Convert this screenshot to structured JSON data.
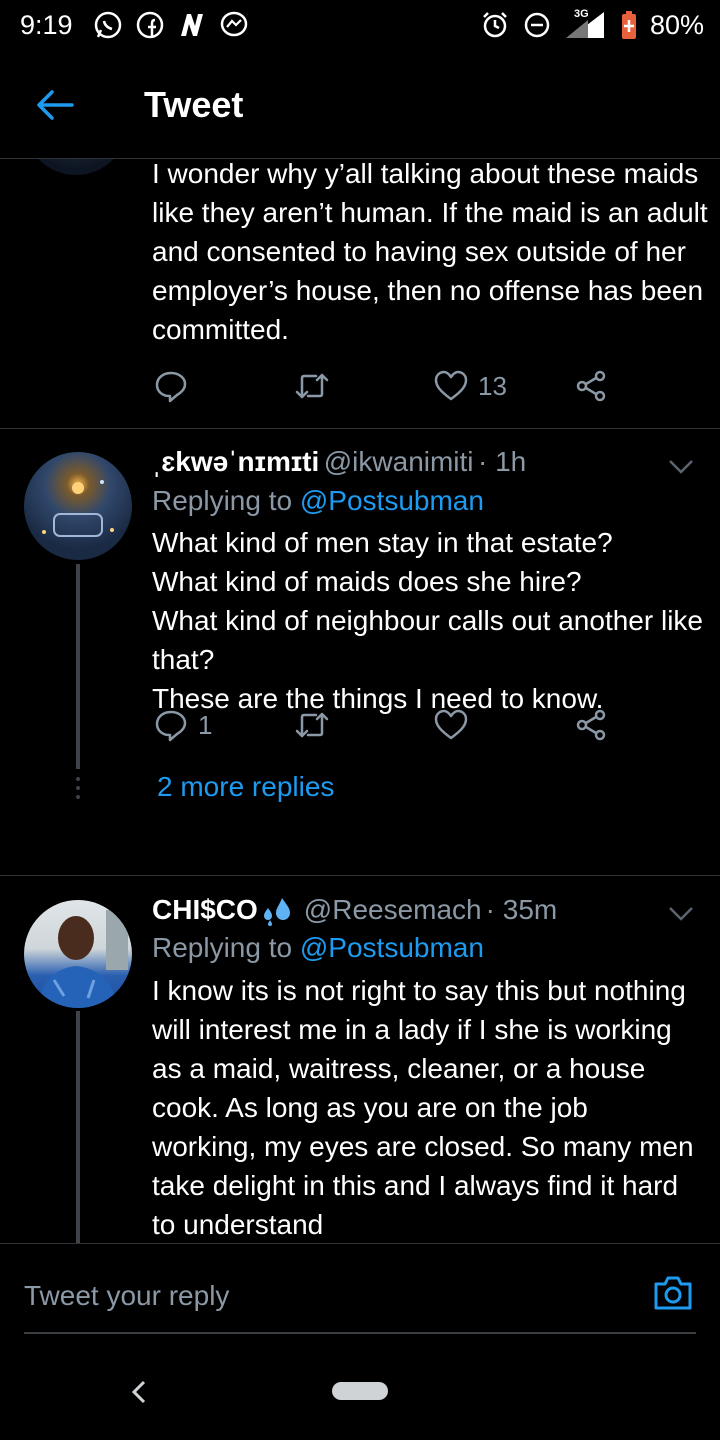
{
  "status_bar": {
    "time": "9:19",
    "network": "3G",
    "battery": "80%",
    "icons": [
      "whatsapp-icon",
      "facebook-icon",
      "n-icon",
      "messenger-icon",
      "alarm-icon",
      "dnd-icon",
      "signal-icon",
      "battery-icon"
    ]
  },
  "header": {
    "title": "Tweet"
  },
  "tweets": [
    {
      "text": "I wonder why y’all talking about these maids like they aren’t human. If the maid is an adult and consented to having sex outside of her employer’s house, then no offense has been committed.",
      "likes": "13"
    },
    {
      "name": "ˌɛkwəˈnɪmɪti",
      "handle": "@ikwanimiti",
      "time": "· 1h",
      "replying_label": "Replying to",
      "replying_to": "@Postsubman",
      "text": "What kind of men stay in that estate?\nWhat kind of maids does she hire?\nWhat kind of neighbour calls out another like that?\nThese are the things I need to know.",
      "replies": "1",
      "more_replies": "2 more replies"
    },
    {
      "name": "CHI$CO",
      "handle": "@Reesemach",
      "time": "· 35m",
      "replying_label": "Replying to",
      "replying_to": "@Postsubman",
      "text": "I know its is not right to say this but nothing will interest me in a lady if I she is working as a maid, waitress, cleaner, or a house cook. As long as you are on the job working,  my eyes are closed. So many men take delight in this and I always find it hard to understand"
    }
  ],
  "reply_bar": {
    "placeholder": "Tweet your reply"
  },
  "colors": {
    "accent": "#1d9bf0",
    "muted": "#8b98a5",
    "background": "#000000"
  }
}
